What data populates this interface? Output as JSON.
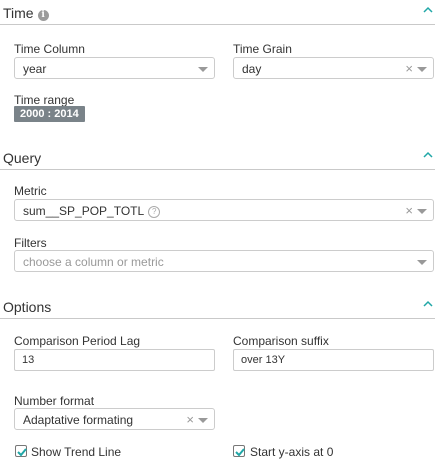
{
  "time": {
    "title": "Time",
    "info_glyph": "i",
    "time_column": {
      "label": "Time Column",
      "value": "year"
    },
    "time_grain": {
      "label": "Time Grain",
      "value": "day"
    },
    "time_range": {
      "label": "Time range",
      "value": "2000 : 2014"
    }
  },
  "query": {
    "title": "Query",
    "metric": {
      "label": "Metric",
      "value": "sum__SP_POP_TOTL",
      "help_glyph": "?"
    },
    "filters": {
      "label": "Filters",
      "placeholder": "choose a column or metric"
    }
  },
  "options": {
    "title": "Options",
    "comparison_period_lag": {
      "label": "Comparison Period Lag",
      "value": "13"
    },
    "comparison_suffix": {
      "label": "Comparison suffix",
      "value": "over 13Y"
    },
    "number_format": {
      "label": "Number format",
      "value": "Adaptative formating"
    },
    "show_trend_line": {
      "label": "Show Trend Line",
      "checked": true
    },
    "start_y_axis_at_0": {
      "label": "Start y-axis at 0",
      "checked": true
    }
  },
  "glyphs": {
    "clear": "×"
  },
  "colors": {
    "accent": "#20a7a7",
    "badge": "#7a8389",
    "checkbox_mark": "#20a7a7"
  }
}
